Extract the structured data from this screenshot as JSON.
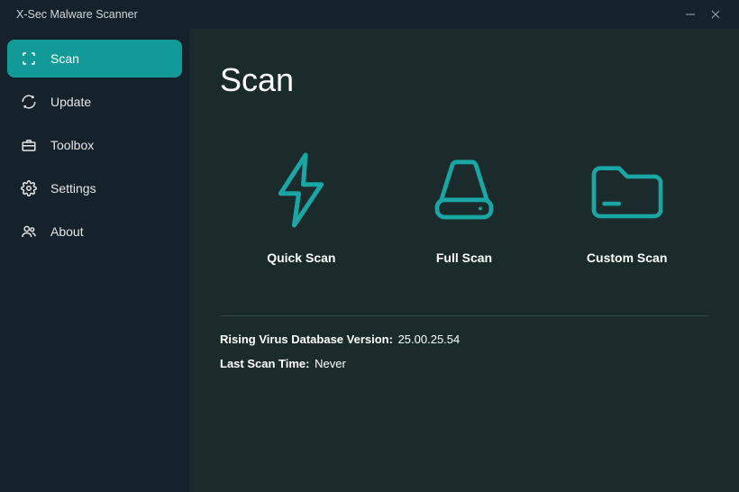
{
  "window": {
    "title": "X-Sec Malware Scanner"
  },
  "sidebar": {
    "items": [
      {
        "label": "Scan"
      },
      {
        "label": "Update"
      },
      {
        "label": "Toolbox"
      },
      {
        "label": "Settings"
      },
      {
        "label": "About"
      }
    ]
  },
  "page": {
    "title": "Scan",
    "scan_options": {
      "quick": "Quick Scan",
      "full": "Full Scan",
      "custom": "Custom Scan"
    },
    "info": {
      "db_label": "Rising Virus Database Version:",
      "db_value": "25.00.25.54",
      "last_scan_label": "Last Scan Time:",
      "last_scan_value": "Never"
    }
  },
  "colors": {
    "accent": "#129a98",
    "icon_accent": "#1aa6a4",
    "sidebar_bg": "#16222b",
    "main_bg": "#1b2b2b"
  }
}
